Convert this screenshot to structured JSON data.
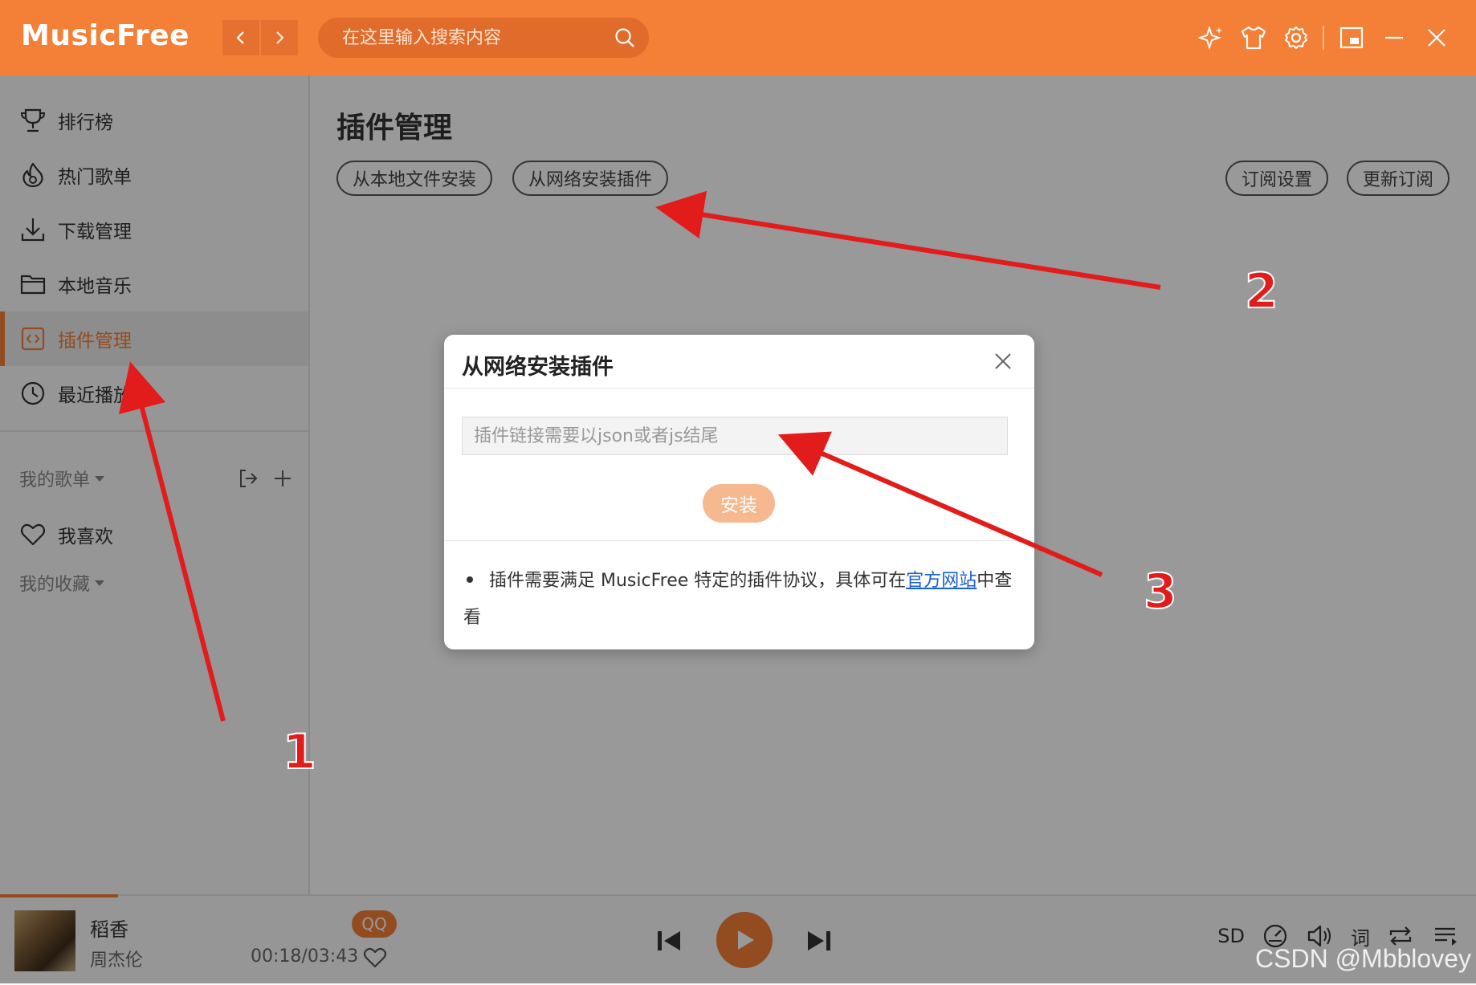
{
  "header": {
    "logo": "MusicFree",
    "search_placeholder": "在这里输入搜索内容",
    "icons": [
      "sparkle-icon",
      "shirt-icon",
      "gear-icon",
      "miniplayer-icon",
      "minimize-icon",
      "close-icon"
    ]
  },
  "sidebar": {
    "items": [
      {
        "label": "排行榜",
        "icon": "trophy-icon"
      },
      {
        "label": "热门歌单",
        "icon": "flame-icon"
      },
      {
        "label": "下载管理",
        "icon": "download-icon"
      },
      {
        "label": "本地音乐",
        "icon": "folder-icon"
      },
      {
        "label": "插件管理",
        "icon": "plugin-icon",
        "active": true
      },
      {
        "label": "最近播放",
        "icon": "clock-icon"
      }
    ],
    "my_playlists": "我的歌单",
    "favorite": "我喜欢",
    "my_collection": "我的收藏"
  },
  "main": {
    "title": "插件管理",
    "buttons": {
      "install_local": "从本地文件安装",
      "install_network": "从网络安装插件",
      "subscription_settings": "订阅设置",
      "update_subscription": "更新订阅"
    }
  },
  "modal": {
    "title": "从网络安装插件",
    "input_placeholder": "插件链接需要以json或者js结尾",
    "install_label": "安装",
    "note_prefix": "插件需要满足 MusicFree 特定的插件协议，具体可在",
    "note_link": "官方网站",
    "note_suffix": "中查看"
  },
  "player": {
    "song_title": "稻香",
    "artist": "周杰伦",
    "source_badge": "QQ",
    "time": "00:18/03:43",
    "progress": 0.08,
    "quality": "SD",
    "lyric_label": "词"
  },
  "annotations": [
    "1",
    "2",
    "3"
  ],
  "watermark": "CSDN @Mbblovey",
  "colors": {
    "accent": "#f47f36",
    "arrow": "#e21b1b",
    "link": "#1a5fd6"
  }
}
